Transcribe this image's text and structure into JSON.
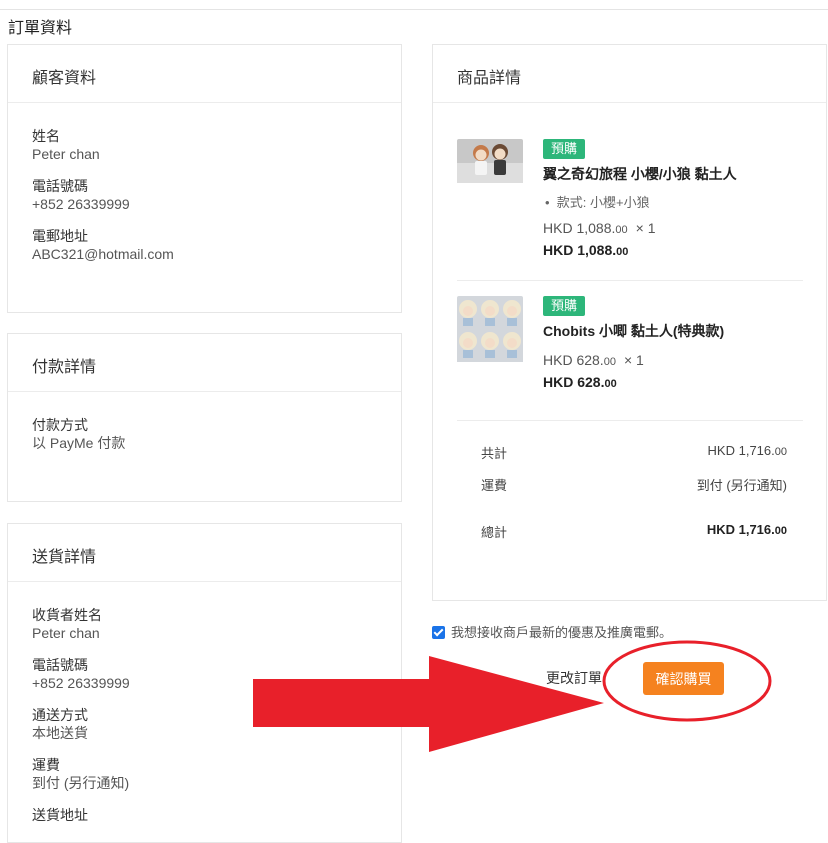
{
  "page_title": "訂單資料",
  "customer": {
    "title": "顧客資料",
    "name_label": "姓名",
    "name_value": "Peter chan",
    "phone_label": "電話號碼",
    "phone_value": "+852 26339999",
    "email_label": "電郵地址",
    "email_value": "ABC321@hotmail.com"
  },
  "payment": {
    "title": "付款詳情",
    "method_label": "付款方式",
    "method_value": "以 PayMe 付款"
  },
  "delivery": {
    "title": "送貨詳情",
    "recipient_label": "收貨者姓名",
    "recipient_value": "Peter chan",
    "phone_label": "電話號碼",
    "phone_value": "+852 26339999",
    "method_label": "通送方式",
    "method_value": "本地送貨",
    "fee_label": "運費",
    "fee_value": "到付 (另行通知)",
    "address_label": "送貨地址"
  },
  "products": {
    "title": "商品詳情",
    "items": [
      {
        "badge": "預購",
        "name": "翼之奇幻旅程 小櫻/小狼 黏土人",
        "option": "款式: 小櫻+小狼",
        "unit_price_main": "HKD 1,088.",
        "unit_price_cents": "00",
        "qty": "× 1",
        "total_main": "HKD 1,088.",
        "total_cents": "00"
      },
      {
        "badge": "預購",
        "name": "Chobits 小唧 黏土人(特典款)",
        "unit_price_main": "HKD 628.",
        "unit_price_cents": "00",
        "qty": "× 1",
        "total_main": "HKD 628.",
        "total_cents": "00"
      }
    ],
    "summary": {
      "subtotal_label": "共計",
      "subtotal_main": "HKD 1,716.",
      "subtotal_cents": "00",
      "shipping_label": "運費",
      "shipping_value": "到付 (另行通知)",
      "total_label": "總計",
      "total_main": "HKD 1,716.",
      "total_cents": "00"
    }
  },
  "newsletter": {
    "checked": true,
    "label": "我想接收商戶最新的優惠及推廣電郵。"
  },
  "actions": {
    "change_order": "更改訂單",
    "confirm": "確認購買"
  },
  "colors": {
    "badge": "#2db67a",
    "confirm_button": "#f5821f",
    "annotation_arrow": "#e8202a",
    "checkbox": "#1a73e8"
  }
}
